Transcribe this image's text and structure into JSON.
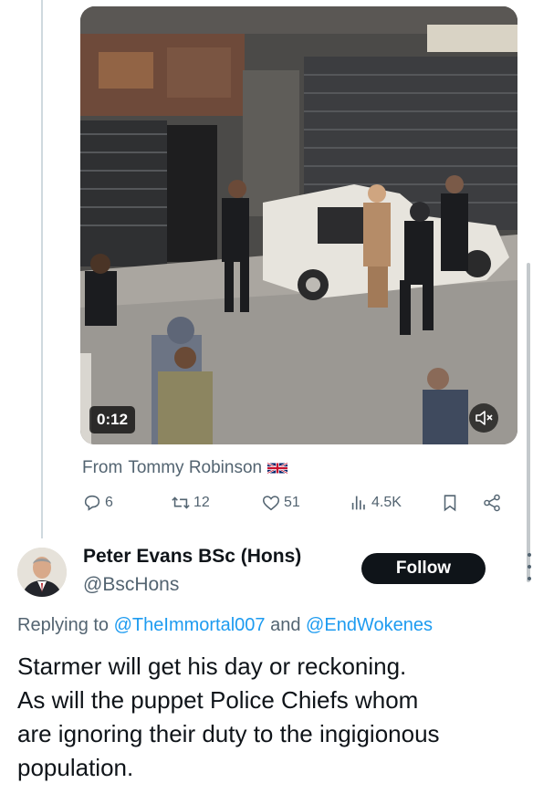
{
  "media": {
    "duration": "0:12",
    "mute_icon": "speaker-muted-icon"
  },
  "source": {
    "prefix": "From",
    "name": "Tommy Robinson",
    "flag_icon": "uk-flag-icon"
  },
  "actions": {
    "replies": "6",
    "reposts": "12",
    "likes": "51",
    "views": "4.5K",
    "icons": [
      "reply-icon",
      "repost-icon",
      "like-icon",
      "views-icon",
      "bookmark-icon",
      "share-icon"
    ]
  },
  "reply": {
    "author_name": "Peter Evans BSc (Hons)",
    "handle": "@BscHons",
    "follow_label": "Follow",
    "replying_prefix": "Replying to",
    "mention_1": "@TheImmortal007",
    "conjunction": "and",
    "mention_2": "@EndWokenes",
    "text_lines": [
      "Starmer will get his day or reckoning.",
      "As will the puppet Police Chiefs whom",
      "are ignoring their duty to the ingigionous",
      "population."
    ]
  },
  "colors": {
    "text": "#0f1419",
    "secondary": "#536471",
    "link": "#1d9bf0",
    "follow_bg": "#0f1419",
    "divider": "#cfd9de"
  }
}
